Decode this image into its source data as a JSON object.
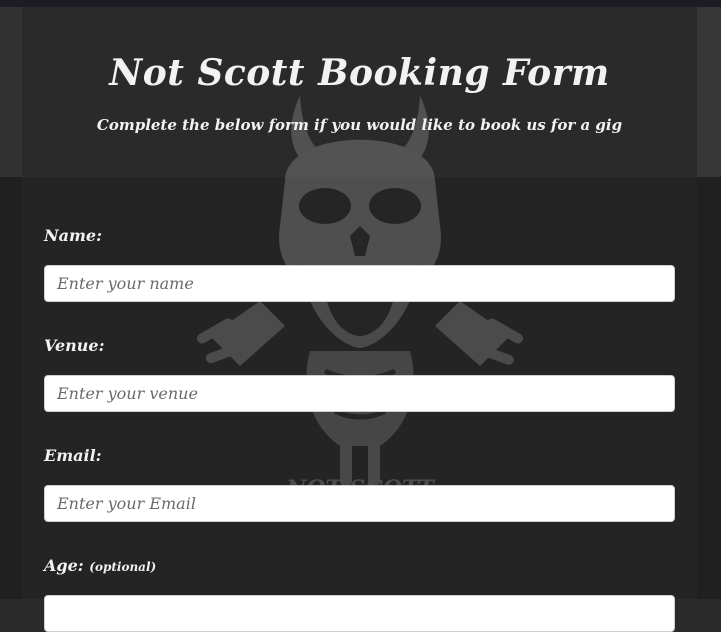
{
  "header": {
    "title": "Not Scott Booking Form",
    "subtitle": "Complete the below form if you would like to book us for a gig"
  },
  "form": {
    "name": {
      "label": "Name:",
      "placeholder": "Enter your name",
      "value": ""
    },
    "venue": {
      "label": "Venue:",
      "placeholder": "Enter your venue",
      "value": ""
    },
    "email": {
      "label": "Email:",
      "placeholder": "Enter your Email",
      "value": ""
    },
    "age": {
      "label": "Age:",
      "optional_note": "(optional)",
      "value": ""
    }
  },
  "background": {
    "watermark_icon": "skull-icon",
    "watermark_text": "NOT SCOTT"
  },
  "colors": {
    "page_bg": "#2b2b2b",
    "form_bg": "#242424",
    "topbar": "#1d1c26",
    "text": "#f2f2f2"
  }
}
